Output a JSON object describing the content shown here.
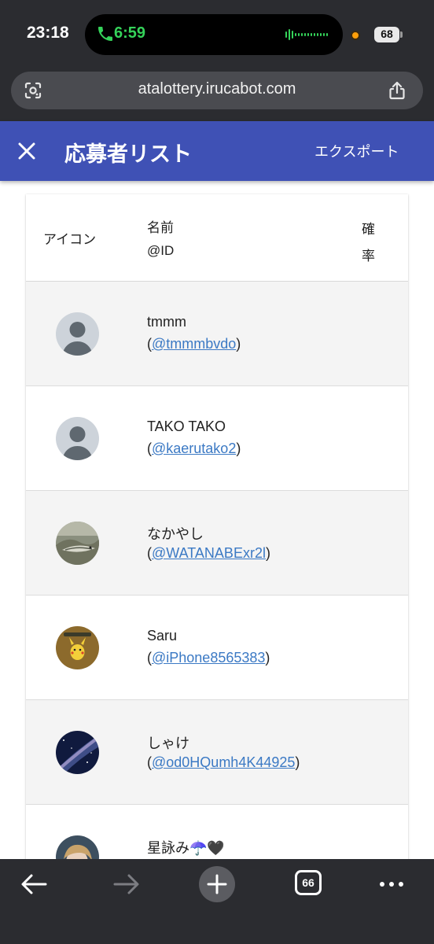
{
  "status_bar": {
    "time": "23:18",
    "call_time": "6:59",
    "battery": "68"
  },
  "browser": {
    "url": "atalottery.irucabot.com",
    "tab_count": "66"
  },
  "appbar": {
    "title": "応募者リスト",
    "export_label": "エクスポート"
  },
  "table": {
    "headers": {
      "icon": "アイコン",
      "name": "名前",
      "id": "@ID",
      "probability": [
        "確",
        "率"
      ]
    },
    "rows": [
      {
        "name": "tmmm",
        "id_prefix": "(",
        "id": "@tmmmbvdo",
        "id_suffix": ")",
        "avatar": "default-avatar"
      },
      {
        "name": "TAKO TAKO",
        "id_prefix": "(",
        "id": "@kaerutako2",
        "id_suffix": ")",
        "avatar": "default-avatar"
      },
      {
        "name": "なかやし",
        "id_prefix": "(",
        "id": "@WATANABExr2l",
        "id_suffix": ")",
        "avatar": "fish-photo-avatar"
      },
      {
        "name": "Saru",
        "id_prefix": "(",
        "id": "@iPhone8565383",
        "id_suffix": ")",
        "avatar": "pikachu-avatar"
      },
      {
        "name": "しゃけ",
        "id_prefix": "(",
        "id": "@od0HQumh4K44925",
        "id_suffix": ")",
        "avatar": "galaxy-avatar"
      },
      {
        "name": "星詠み☂️🖤",
        "id_prefix": "",
        "id": "",
        "id_suffix": "",
        "avatar": "anime-avatar"
      }
    ]
  },
  "colors": {
    "appbar": "#3f51b5",
    "link": "#3b79c4",
    "row_alt": "#f4f4f4",
    "chrome": "#2b2c30",
    "call_green": "#35d35a"
  }
}
